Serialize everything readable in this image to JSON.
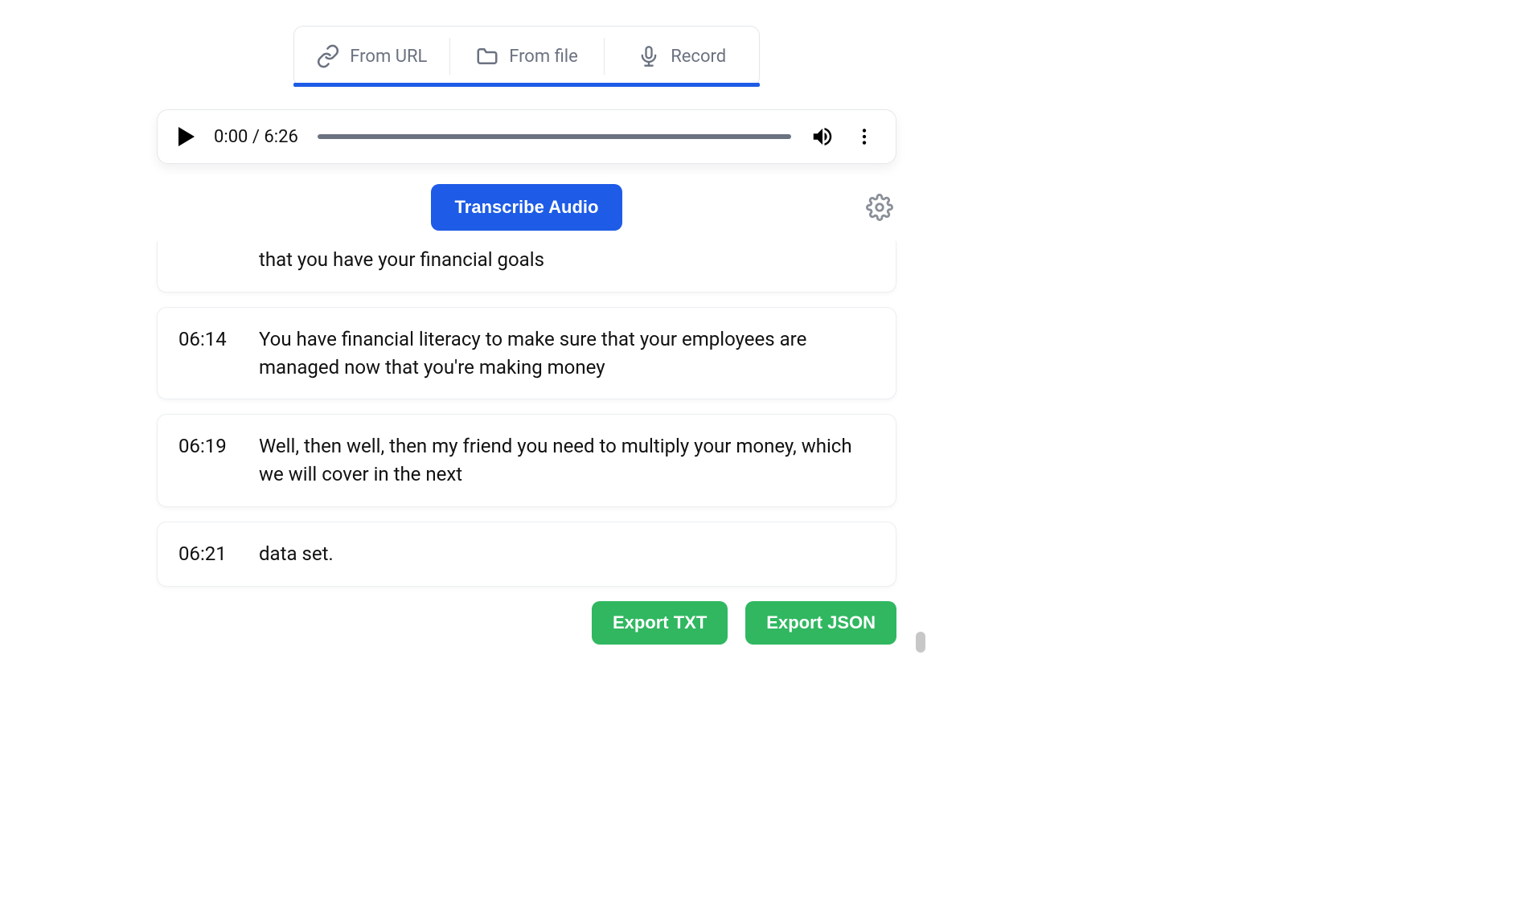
{
  "tabs": {
    "from_url": "From URL",
    "from_file": "From file",
    "record": "Record"
  },
  "player": {
    "current_time": "0:00",
    "total_time": "6:26",
    "separator": " / "
  },
  "actions": {
    "transcribe_label": "Transcribe Audio"
  },
  "transcript": [
    {
      "time": "",
      "text": "that you have your financial goals"
    },
    {
      "time": "06:14",
      "text": "You have financial literacy to make sure that your employees are managed now that you're making money"
    },
    {
      "time": "06:19",
      "text": "Well, then well, then my friend you need to multiply your money, which we will cover in the next"
    },
    {
      "time": "06:21",
      "text": "data set."
    }
  ],
  "export": {
    "txt_label": "Export TXT",
    "json_label": "Export JSON"
  }
}
